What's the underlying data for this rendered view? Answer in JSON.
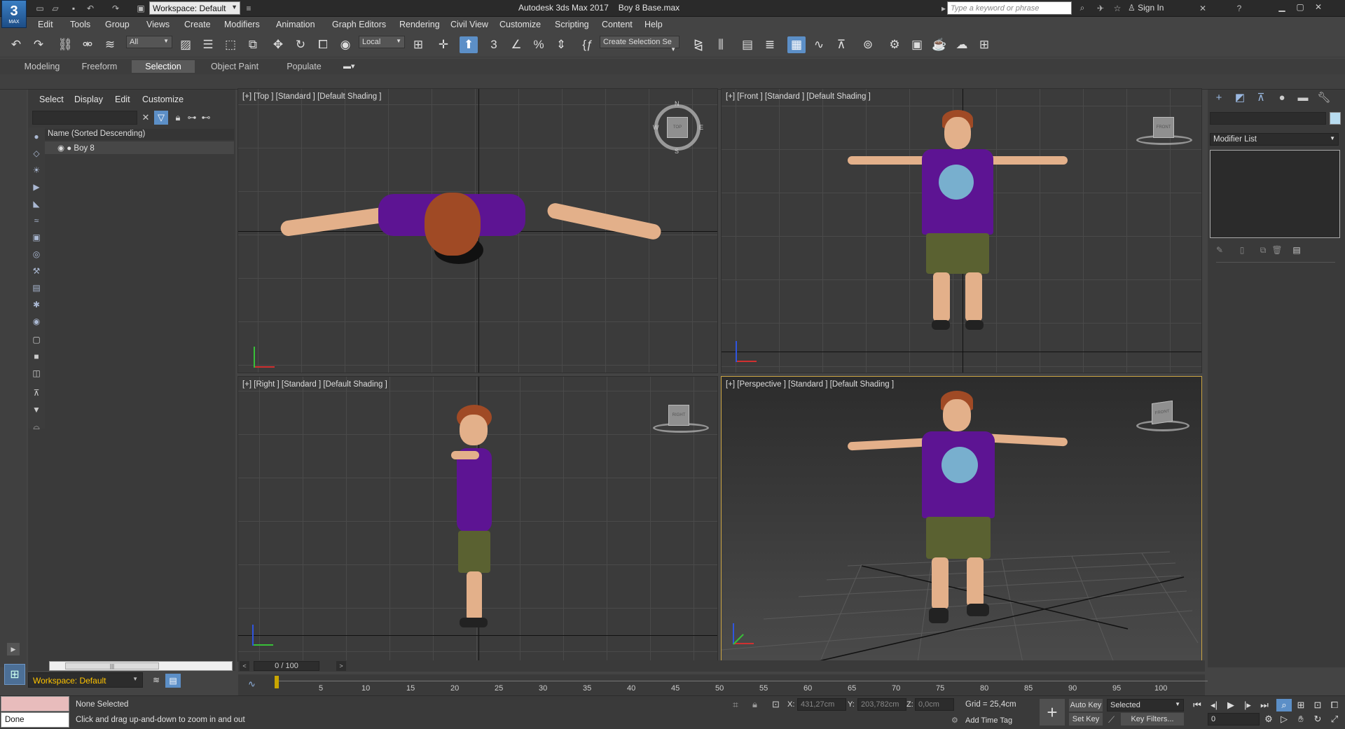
{
  "app": {
    "title": "Autodesk 3ds Max 2017",
    "file": "Boy 8 Base.max",
    "logo_text": "3",
    "logo_sub": "MAX",
    "workspace": "Workspace: Default",
    "search_placeholder": "Type a keyword or phrase",
    "sign_in": "Sign In"
  },
  "menu": [
    "Edit",
    "Tools",
    "Group",
    "Views",
    "Create",
    "Modifiers",
    "Animation",
    "Graph Editors",
    "Rendering",
    "Civil View",
    "Customize",
    "Scripting",
    "Content",
    "Help"
  ],
  "toolbar": {
    "filter_dropdown": "All",
    "coord_dropdown": "Local",
    "selection_set": "Create Selection Se"
  },
  "ribbon_tabs": [
    "Modeling",
    "Freeform",
    "Selection",
    "Object Paint",
    "Populate"
  ],
  "ribbon_active": "Selection",
  "explorer": {
    "menus": [
      "Select",
      "Display",
      "Edit",
      "Customize"
    ],
    "column_header": "Name (Sorted Descending)",
    "items": [
      {
        "name": "Boy 8"
      }
    ],
    "workspace": "Workspace: Default"
  },
  "viewports": {
    "top": {
      "label": "[+] [Top ] [Standard ] [Default Shading ]",
      "compass": {
        "n": "N",
        "s": "S",
        "e": "E",
        "w": "W",
        "cube": "TOP"
      }
    },
    "front": {
      "label": "[+] [Front ] [Standard ] [Default Shading ]",
      "cube": "FRONT"
    },
    "right": {
      "label": "[+] [Right ] [Standard ] [Default Shading ]",
      "cube": "RIGHT"
    },
    "persp": {
      "label": "[+] [Perspective ] [Standard ] [Default Shading ]",
      "cube": "FRONT"
    }
  },
  "command_panel": {
    "modifier_list": "Modifier List"
  },
  "timeline": {
    "frame_display": "0 / 100",
    "ticks": [
      "5",
      "10",
      "15",
      "20",
      "25",
      "30",
      "35",
      "40",
      "45",
      "50",
      "55",
      "60",
      "65",
      "70",
      "75",
      "80",
      "85",
      "90",
      "95",
      "100"
    ]
  },
  "status": {
    "selection": "None Selected",
    "prompt": "Click and drag up-and-down to zoom in and out",
    "done": "Done",
    "x_label": "X:",
    "x_value": "431,27cm",
    "y_label": "Y:",
    "y_value": "203,782cm",
    "z_label": "Z:",
    "z_value": "0,0cm",
    "grid": "Grid = 25,4cm",
    "add_time_tag": "Add Time Tag",
    "auto_key": "Auto Key",
    "set_key": "Set Key",
    "key_mode": "Selected",
    "key_filters": "Key Filters...",
    "current_frame": "0"
  }
}
